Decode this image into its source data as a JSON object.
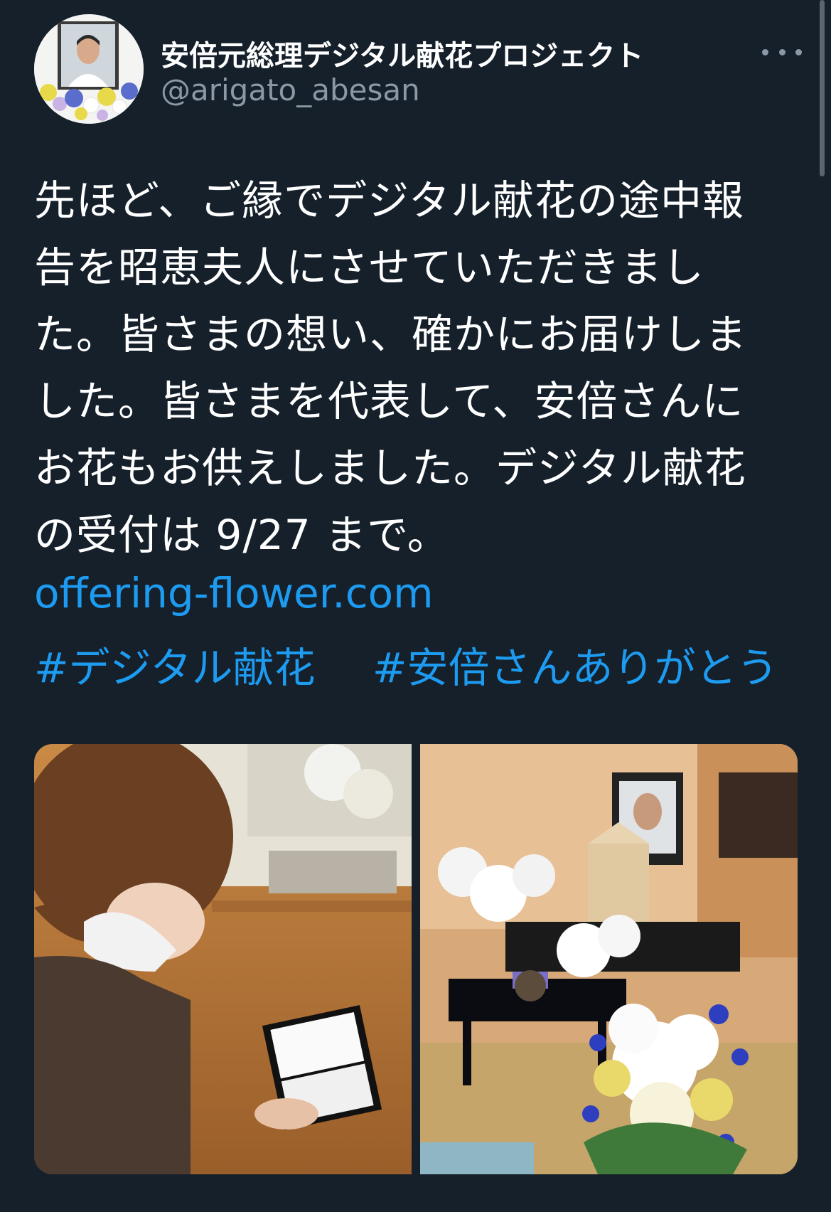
{
  "tweet": {
    "author": {
      "display_name": "安倍元総理デジタル献花プロジェクト",
      "handle": "@arigato_abesan",
      "avatar_icon": "profile-avatar-portrait-with-flowers"
    },
    "more_icon": "more-options-icon",
    "text_lines": [
      "先ほど、ご縁でデジタル献花の途中報",
      "告を昭恵夫人にさせていただきまし",
      "た。皆さまの想い、確かにお届けしま",
      "した。皆さまを代表して、安倍さんに",
      "お花もお供えしました。デジタル献花",
      "の受付は 9/27 まで。"
    ],
    "link": "offering-flower.com",
    "hashtags": [
      "#デジタル献花",
      "#安倍さんありがとう"
    ],
    "media": [
      {
        "description_icon": "photo-woman-reading-book"
      },
      {
        "description_icon": "photo-altar-with-flowers"
      }
    ]
  },
  "colors": {
    "background": "#15202b",
    "text": "#ffffff",
    "secondary_text": "#8b98a5",
    "link": "#1d9bf0"
  }
}
